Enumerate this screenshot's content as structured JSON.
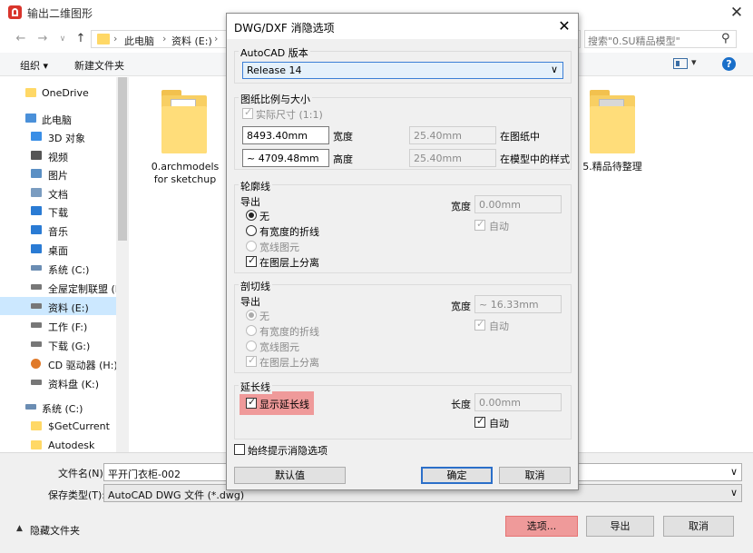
{
  "explorer": {
    "title": "输出二维图形",
    "breadcrumbs": [
      "此电脑",
      "资料 (E:)"
    ],
    "breadcrumb_separator": "›",
    "search_placeholder": "搜索\"0.SU精品模型\"",
    "toolbar": {
      "organize": "组织 ▾",
      "new_folder": "新建文件夹"
    },
    "sidebar": [
      {
        "label": "OneDrive",
        "icon": "folder-icon",
        "color": "#ffd866"
      },
      {
        "label": "此电脑",
        "icon": "computer-icon",
        "color": "#4a90d9"
      },
      {
        "label": "3D 对象",
        "icon": "cube-icon",
        "color": "#3a8ee6"
      },
      {
        "label": "视频",
        "icon": "video-icon",
        "color": "#555555"
      },
      {
        "label": "图片",
        "icon": "picture-icon",
        "color": "#5a8fc4"
      },
      {
        "label": "文档",
        "icon": "document-icon",
        "color": "#7a9cc0"
      },
      {
        "label": "下载",
        "icon": "download-icon",
        "color": "#2a7bd4"
      },
      {
        "label": "音乐",
        "icon": "music-icon",
        "color": "#2a7bd4"
      },
      {
        "label": "桌面",
        "icon": "desktop-icon",
        "color": "#2a7bd4"
      },
      {
        "label": "系统 (C:)",
        "icon": "drive-icon",
        "color": "#6b8db3"
      },
      {
        "label": "全屋定制联盟 (D",
        "icon": "drive-icon",
        "color": "#777777"
      },
      {
        "label": "资料 (E:)",
        "icon": "drive-icon",
        "color": "#777777",
        "selected": true
      },
      {
        "label": "工作 (F:)",
        "icon": "drive-icon",
        "color": "#777777"
      },
      {
        "label": "下载 (G:)",
        "icon": "drive-icon",
        "color": "#777777"
      },
      {
        "label": "CD 驱动器 (H:) I",
        "icon": "cd-drive-icon",
        "color": "#e07a2a"
      },
      {
        "label": "资料盘 (K:)",
        "icon": "drive-icon",
        "color": "#777777"
      },
      {
        "label": "系统 (C:)",
        "icon": "drive-icon",
        "color": "#6b8db3"
      },
      {
        "label": "$GetCurrent",
        "icon": "folder-icon",
        "color": "#ffd866"
      },
      {
        "label": "Autodesk",
        "icon": "folder-icon",
        "color": "#ffd866"
      }
    ],
    "files": [
      {
        "name": "0.archmodels\nfor sketchup",
        "line1": "0.archmodels",
        "line2": "for sketchup"
      },
      {
        "name": "5.精品待整理",
        "line1": "5.精品待整理",
        "line2": ""
      }
    ],
    "filename_label": "文件名(N):",
    "filename_value": "平开门衣柜-002",
    "savetype_label": "保存类型(T):",
    "savetype_value": "AutoCAD DWG 文件 (*.dwg)",
    "hide_folders": "隐藏文件夹",
    "buttons": {
      "options": "选项...",
      "export": "导出",
      "cancel": "取消"
    }
  },
  "dialog": {
    "title": "DWG/DXF 消隐选项",
    "close": "✕",
    "autocad_version": {
      "label": "AutoCAD 版本",
      "selected": "Release 14"
    },
    "scale": {
      "label": "图纸比例与大小",
      "actual_size": "实际尺寸 (1:1)",
      "width_value": "8493.40mm",
      "width_label": "宽度",
      "width_paper": "25.40mm",
      "in_paper": "在图纸中",
      "height_value": "~ 4709.48mm",
      "height_label": "高度",
      "height_paper": "25.40mm",
      "in_model": "在模型中的样式"
    },
    "profile": {
      "label": "轮廓线",
      "export": "导出",
      "opt_none": "无",
      "opt_polyline": "有宽度的折线",
      "opt_wide": "宽线图元",
      "separate": "在图层上分离",
      "width_label": "宽度",
      "width_value": "0.00mm",
      "auto": "自动"
    },
    "section": {
      "label": "剖切线",
      "export": "导出",
      "opt_none": "无",
      "opt_polyline": "有宽度的折线",
      "opt_wide": "宽线图元",
      "separate": "在图层上分离",
      "width_label": "宽度",
      "width_value": "~ 16.33mm",
      "auto": "自动"
    },
    "extension": {
      "label": "延长线",
      "show": "显示延长线",
      "length_label": "长度",
      "length_value": "0.00mm",
      "auto": "自动"
    },
    "always_prompt": "始终提示消隐选项",
    "buttons": {
      "defaults": "默认值",
      "ok": "确定",
      "cancel": "取消"
    }
  }
}
